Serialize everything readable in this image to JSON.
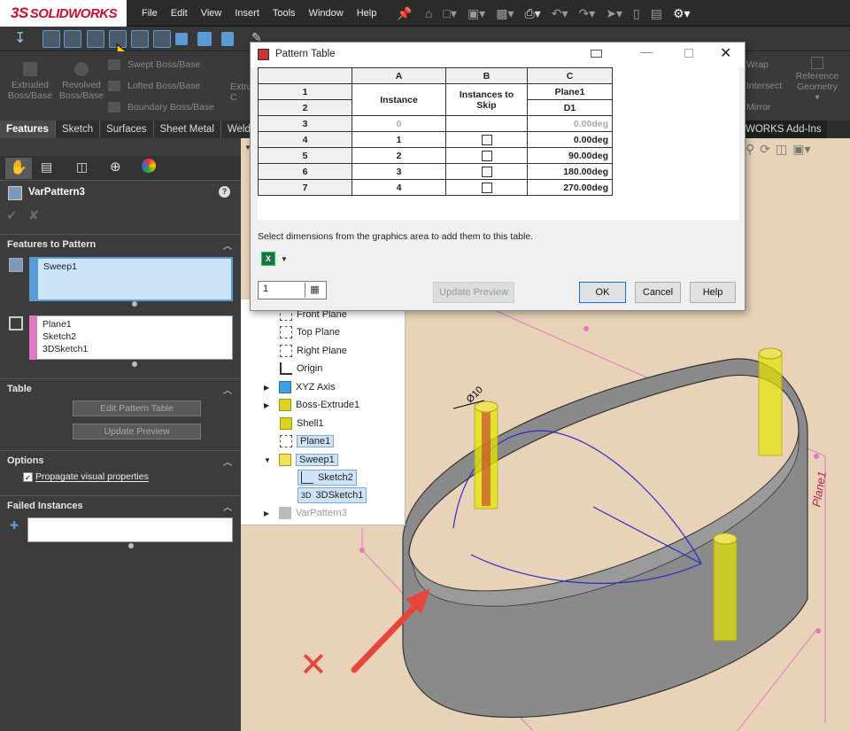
{
  "app": {
    "brand": "SOLIDWORKS",
    "brand_prefix": "3S",
    "menu": [
      "File",
      "Edit",
      "View",
      "Insert",
      "Tools",
      "Window",
      "Help"
    ]
  },
  "ribbon": {
    "items": [
      {
        "label": "Extruded\nBoss/Base"
      },
      {
        "label": "Revolved\nBoss/Base"
      },
      {
        "label": "Swept Boss/Base"
      },
      {
        "label": "Lofted Boss/Base"
      },
      {
        "label": "Boundary Boss/Base"
      },
      {
        "label": "Extru\nC"
      },
      {
        "label": "Wrap"
      },
      {
        "label": "Intersect"
      },
      {
        "label": "Mirror"
      },
      {
        "label": "Reference\nGeometry"
      }
    ]
  },
  "tabs": [
    "Features",
    "Sketch",
    "Surfaces",
    "Sheet Metal",
    "Weldm"
  ],
  "addins_label": "WORKS Add-Ins",
  "property_manager": {
    "title": "VarPattern3",
    "features_to_pattern": {
      "header": "Features to Pattern",
      "items": [
        "Sweep1"
      ]
    },
    "references": {
      "items": [
        "Plane1",
        "Sketch2",
        "3DSketch1"
      ]
    },
    "table": {
      "header": "Table",
      "edit_button": "Edit Pattern Table",
      "update_button": "Update Preview"
    },
    "options": {
      "header": "Options",
      "propagate_label": "Propagate visual properties",
      "propagate_checked": true
    },
    "failed": {
      "header": "Failed Instances"
    }
  },
  "tree": {
    "items": [
      {
        "label": "Front Plane"
      },
      {
        "label": "Top Plane"
      },
      {
        "label": "Right Plane"
      },
      {
        "label": "Origin"
      },
      {
        "label": "XYZ Axis"
      },
      {
        "label": "Boss-Extrude1"
      },
      {
        "label": "Shell1"
      },
      {
        "label": "Plane1"
      },
      {
        "label": "Sweep1"
      },
      {
        "label": "Sketch2"
      },
      {
        "label": "3DSketch1",
        "prefix": "3D"
      },
      {
        "label": "VarPattern3"
      }
    ]
  },
  "dialog": {
    "title": "Pattern Table",
    "columns": [
      "A",
      "B",
      "C"
    ],
    "header_rows": [
      "1",
      "2"
    ],
    "col_a_header": "Instance",
    "col_b_header": "Instances to Skip",
    "col_c_header1": "Plane1",
    "col_c_header2": "D1",
    "rows": [
      {
        "row": "3",
        "instance": "0",
        "skip": false,
        "value": "0.00deg",
        "gray": true
      },
      {
        "row": "4",
        "instance": "1",
        "skip": false,
        "value": "0.00deg",
        "gray": false
      },
      {
        "row": "5",
        "instance": "2",
        "skip": false,
        "value": "90.00deg",
        "gray": false
      },
      {
        "row": "6",
        "instance": "3",
        "skip": false,
        "value": "180.00deg",
        "gray": false
      },
      {
        "row": "7",
        "instance": "4",
        "skip": false,
        "value": "270.00deg",
        "gray": false
      }
    ],
    "hint": "Select dimensions from the graphics area to add them to this table.",
    "spin_value": "1",
    "buttons": {
      "update": "Update Preview",
      "ok": "OK",
      "cancel": "Cancel",
      "help": "Help"
    }
  },
  "viewport": {
    "plane_label": "Plane1",
    "dim_label": "Ø10"
  },
  "colors": {
    "accent": "#f33",
    "selection": "#cfe3f7",
    "sweep_yellow": "#e6e600"
  }
}
